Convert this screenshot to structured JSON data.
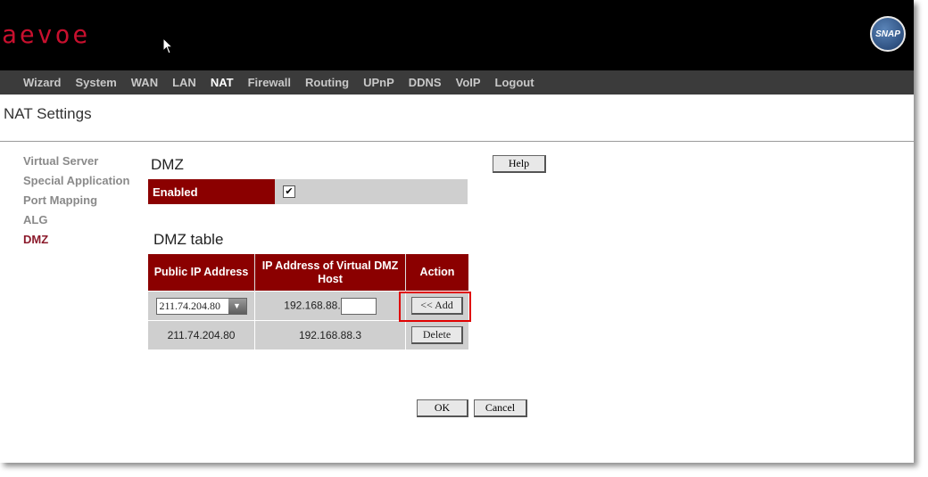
{
  "header": {
    "logo": "aevoe",
    "badge": "SNAP"
  },
  "nav": {
    "items": [
      "Wizard",
      "System",
      "WAN",
      "LAN",
      "NAT",
      "Firewall",
      "Routing",
      "UPnP",
      "DDNS",
      "VoIP",
      "Logout"
    ],
    "active": "NAT"
  },
  "page": {
    "title": "NAT Settings"
  },
  "sidebar": {
    "items": [
      "Virtual Server",
      "Special Application",
      "Port Mapping",
      "ALG",
      "DMZ"
    ],
    "active": "DMZ"
  },
  "dmz": {
    "title": "DMZ",
    "enabled_label": "Enabled",
    "enabled_checked": true,
    "help_label": "Help"
  },
  "table": {
    "title": "DMZ table",
    "headers": [
      "Public IP Address",
      "IP Address of Virtual DMZ Host",
      "Action"
    ],
    "input_row": {
      "public_ip": "211.74.204.80",
      "host_prefix": "192.168.88.",
      "host_suffix": "",
      "action": "<< Add"
    },
    "rows": [
      {
        "public_ip": "211.74.204.80",
        "host": "192.168.88.3",
        "action": "Delete"
      }
    ]
  },
  "buttons": {
    "ok": "OK",
    "cancel": "Cancel"
  },
  "colors": {
    "accent": "#8b0000",
    "highlight": "#e00000",
    "nav_bg": "#3b3b3b"
  }
}
